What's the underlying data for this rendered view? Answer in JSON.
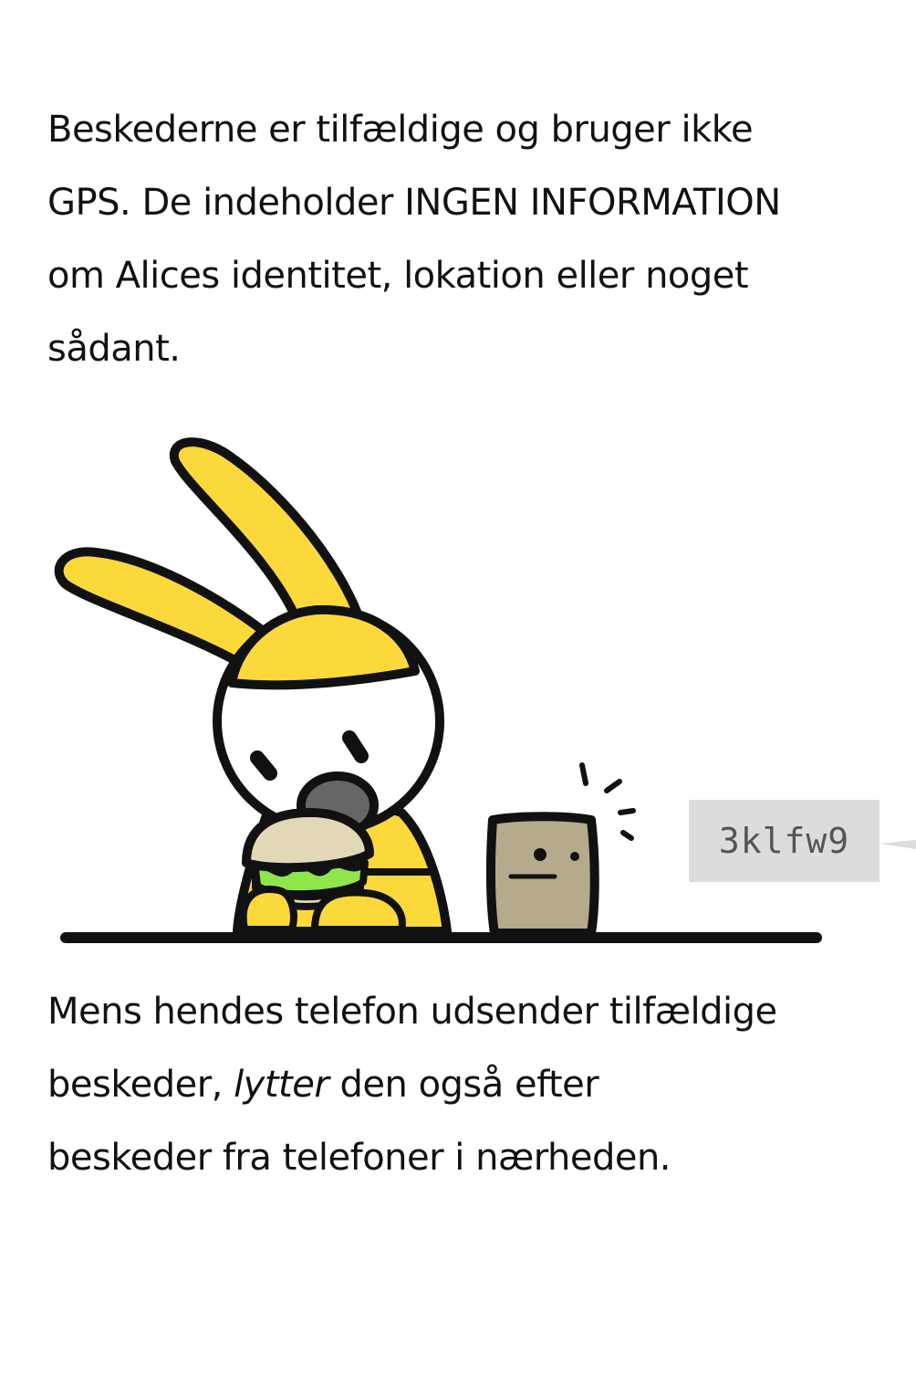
{
  "caption_top": {
    "lines": [
      "Beskederne er tilfældige og bruger ikke",
      "GPS. De indeholder INGEN INFORMATION",
      "om Alices identitet, lokation eller noget",
      "sådant."
    ]
  },
  "message_tag": {
    "text": "3klfw9"
  },
  "caption_bottom": {
    "line1": "Mens hendes telefon udsender tilfældige",
    "line2_before": "beskeder, ",
    "line2_emphasis": "lytter",
    "line2_after": " den også efter",
    "line3": "beskeder fra telefoner i nærheden."
  },
  "colors": {
    "ears": "#fcd93a",
    "outline": "#111111",
    "face": "#ffffff",
    "phone": "#b5aa8c",
    "lettuce": "#8ee64a",
    "bun": "#e2d8b8",
    "tag_bg": "#dcdcdc",
    "tag_text": "#555555"
  }
}
